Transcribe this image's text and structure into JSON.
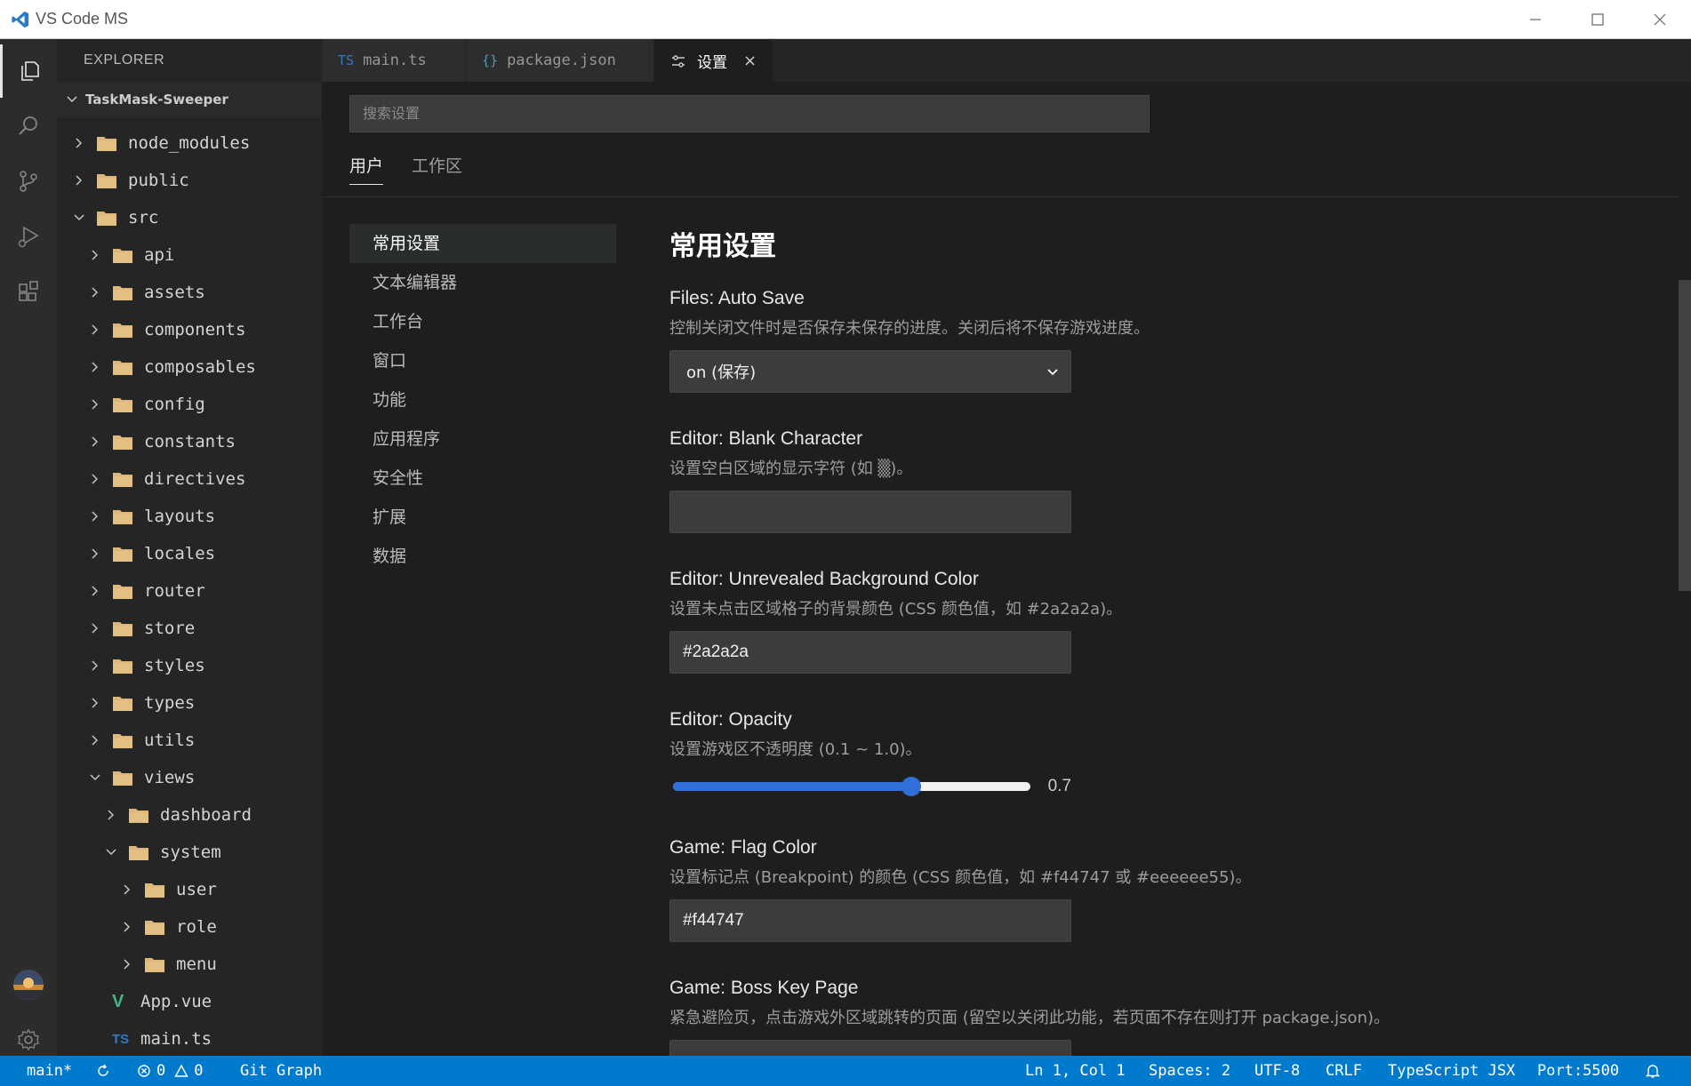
{
  "window": {
    "title": "VS Code MS"
  },
  "explorer": {
    "header": "EXPLORER",
    "project": "TaskMask-Sweeper",
    "tree": [
      {
        "label": "node_modules",
        "kind": "folder",
        "depth": 0,
        "expanded": false
      },
      {
        "label": "public",
        "kind": "folder",
        "depth": 0,
        "expanded": false
      },
      {
        "label": "src",
        "kind": "folder",
        "depth": 0,
        "expanded": true
      },
      {
        "label": "api",
        "kind": "folder",
        "depth": 1,
        "expanded": false
      },
      {
        "label": "assets",
        "kind": "folder",
        "depth": 1,
        "expanded": false
      },
      {
        "label": "components",
        "kind": "folder",
        "depth": 1,
        "expanded": false
      },
      {
        "label": "composables",
        "kind": "folder",
        "depth": 1,
        "expanded": false
      },
      {
        "label": "config",
        "kind": "folder",
        "depth": 1,
        "expanded": false
      },
      {
        "label": "constants",
        "kind": "folder",
        "depth": 1,
        "expanded": false
      },
      {
        "label": "directives",
        "kind": "folder",
        "depth": 1,
        "expanded": false
      },
      {
        "label": "layouts",
        "kind": "folder",
        "depth": 1,
        "expanded": false
      },
      {
        "label": "locales",
        "kind": "folder",
        "depth": 1,
        "expanded": false
      },
      {
        "label": "router",
        "kind": "folder",
        "depth": 1,
        "expanded": false
      },
      {
        "label": "store",
        "kind": "folder",
        "depth": 1,
        "expanded": false
      },
      {
        "label": "styles",
        "kind": "folder",
        "depth": 1,
        "expanded": false
      },
      {
        "label": "types",
        "kind": "folder",
        "depth": 1,
        "expanded": false
      },
      {
        "label": "utils",
        "kind": "folder",
        "depth": 1,
        "expanded": false
      },
      {
        "label": "views",
        "kind": "folder",
        "depth": 1,
        "expanded": true
      },
      {
        "label": "dashboard",
        "kind": "folder",
        "depth": 2,
        "expanded": false
      },
      {
        "label": "system",
        "kind": "folder",
        "depth": 2,
        "expanded": true
      },
      {
        "label": "user",
        "kind": "folder",
        "depth": 3,
        "expanded": false
      },
      {
        "label": "role",
        "kind": "folder",
        "depth": 3,
        "expanded": false
      },
      {
        "label": "menu",
        "kind": "folder",
        "depth": 3,
        "expanded": false
      },
      {
        "label": "App.vue",
        "kind": "vue",
        "depth": 1,
        "icon_text": "V"
      },
      {
        "label": "main.ts",
        "kind": "ts",
        "depth": 1,
        "icon_text": "TS"
      }
    ]
  },
  "tabs": [
    {
      "icon_text": "TS",
      "label": "main.ts",
      "icon_color": "#3178c6",
      "active": false
    },
    {
      "icon_text": "{}",
      "label": "package.json",
      "icon_color": "#519aba",
      "active": false
    },
    {
      "icon_text": "",
      "label": "设置",
      "active": true,
      "close": "×"
    }
  ],
  "settings": {
    "search_placeholder": "搜索设置",
    "scopes": [
      "用户",
      "工作区"
    ],
    "toc": [
      "常用设置",
      "文本编辑器",
      "工作台",
      "窗口",
      "功能",
      "应用程序",
      "安全性",
      "扩展",
      "数据"
    ],
    "section_title": "常用设置",
    "items": [
      {
        "type": "select",
        "label": "Files: Auto Save",
        "desc": "控制关闭文件时是否保存未保存的进度。关闭后将不保存游戏进度。",
        "value": "on (保存)"
      },
      {
        "type": "input",
        "label": "Editor: Blank Character",
        "desc": "设置空白区域的显示字符 (如 ▒)。",
        "value": ""
      },
      {
        "type": "input",
        "label": "Editor: Unrevealed Background Color",
        "desc": "设置未点击区域格子的背景颜色 (CSS 颜色值，如 #2a2a2a)。",
        "value": "#2a2a2a"
      },
      {
        "type": "slider",
        "label": "Editor: Opacity",
        "desc": "设置游戏区不透明度 (0.1 ~ 1.0)。",
        "value": "0.7",
        "min": 0.1,
        "max": 1.0,
        "num": 0.7
      },
      {
        "type": "input",
        "label": "Game: Flag Color",
        "desc": "设置标记点 (Breakpoint) 的颜色 (CSS 颜色值，如 #f44747 或 #eeeeee55)。",
        "value": "#f44747"
      },
      {
        "type": "input",
        "label": "Game: Boss Key Page",
        "desc": "紧急避险页，点击游戏外区域跳转的页面 (留空以关闭此功能，若页面不存在则打开 package.json)。",
        "value": ""
      }
    ]
  },
  "statusbar": {
    "branch": "main*",
    "errors": "0",
    "warnings": "0",
    "git_graph": "Git Graph",
    "position": "Ln 1, Col 1",
    "spaces": "Spaces: 2",
    "encoding": "UTF-8",
    "eol": "CRLF",
    "language": "TypeScript JSX",
    "port": "Port:5500"
  },
  "colors": {
    "accent": "#007acc",
    "folder": "#dcb67a",
    "ts": "#3178c6",
    "vue": "#41b883",
    "slider": "#2f6fd7"
  },
  "icons": {
    "activity": [
      "files-icon",
      "search-icon",
      "source-control-icon",
      "run-debug-icon",
      "extensions-icon",
      "account-avatar",
      "gear-icon"
    ]
  }
}
